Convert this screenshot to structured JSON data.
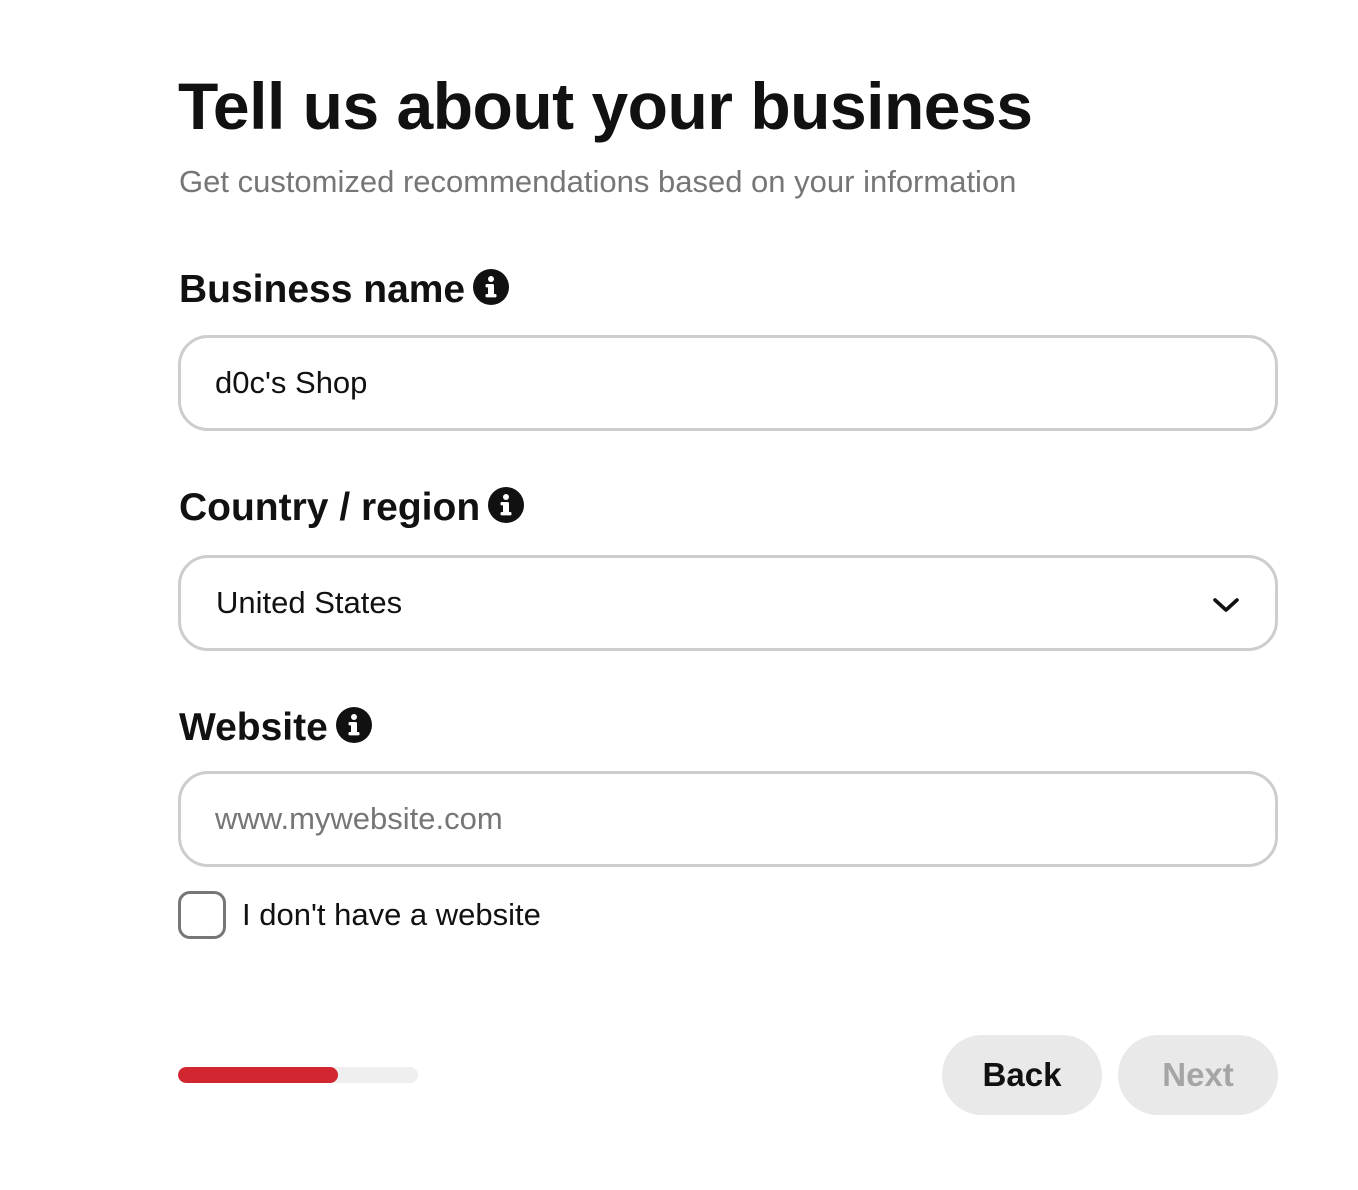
{
  "header": {
    "title": "Tell us about your business",
    "subtitle": "Get customized recommendations based on your information"
  },
  "form": {
    "business_name": {
      "label": "Business name",
      "value": "d0c's Shop",
      "info_icon": "info-icon"
    },
    "country_region": {
      "label": "Country / region",
      "selected": "United States",
      "info_icon": "info-icon",
      "dropdown_icon": "chevron-down-icon"
    },
    "website": {
      "label": "Website",
      "placeholder": "www.mywebsite.com",
      "value": "",
      "info_icon": "info-icon"
    },
    "no_website": {
      "label": "I don't have a website",
      "checked": false
    }
  },
  "progress": {
    "fraction": 0.667
  },
  "footer": {
    "back_label": "Back",
    "next_label": "Next",
    "next_enabled": false
  },
  "colors": {
    "progress_fill": "#d1252f",
    "progress_track": "#efefef",
    "button_bg": "#e9e9e9",
    "disabled_text": "#a5a5a5",
    "input_border": "#cdcdcd"
  }
}
